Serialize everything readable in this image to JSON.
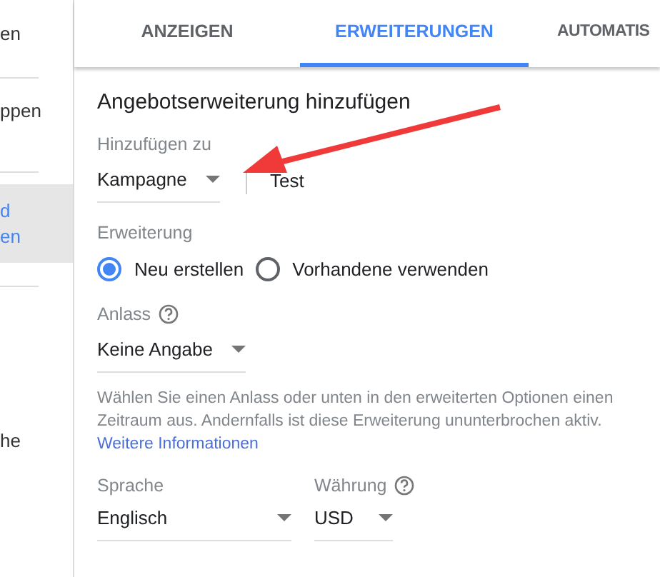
{
  "sidebar": {
    "items": [
      {
        "lines": [
          "en"
        ],
        "selected": false
      },
      {
        "lines": [
          "ppen"
        ],
        "selected": false
      },
      {
        "lines": [
          "d",
          "en"
        ],
        "selected": true
      },
      {
        "lines": [
          "he"
        ],
        "selected": false
      }
    ]
  },
  "tabs": [
    {
      "label": "ANZEIGEN",
      "selected": false
    },
    {
      "label": "ERWEITERUNGEN",
      "selected": true
    },
    {
      "label": "AUTOMATIS",
      "selected": false
    }
  ],
  "form": {
    "title": "Angebotserweiterung hinzufügen",
    "add_to": {
      "label": "Hinzufügen zu",
      "value": "Kampagne",
      "target": "Test"
    },
    "extension": {
      "label": "Erweiterung",
      "options": [
        {
          "label": "Neu erstellen",
          "selected": true
        },
        {
          "label": "Vorhandene verwenden",
          "selected": false
        }
      ]
    },
    "occasion": {
      "label": "Anlass",
      "value": "Keine Angabe",
      "help": "Wählen Sie einen Anlass oder unten in den erweiterten Optionen einen Zeitraum aus. Andernfalls ist diese Erweiterung ununterbrochen aktiv.",
      "link": "Weitere Informationen"
    },
    "language": {
      "label": "Sprache",
      "value": "Englisch"
    },
    "currency": {
      "label": "Währung",
      "value": "USD"
    }
  }
}
